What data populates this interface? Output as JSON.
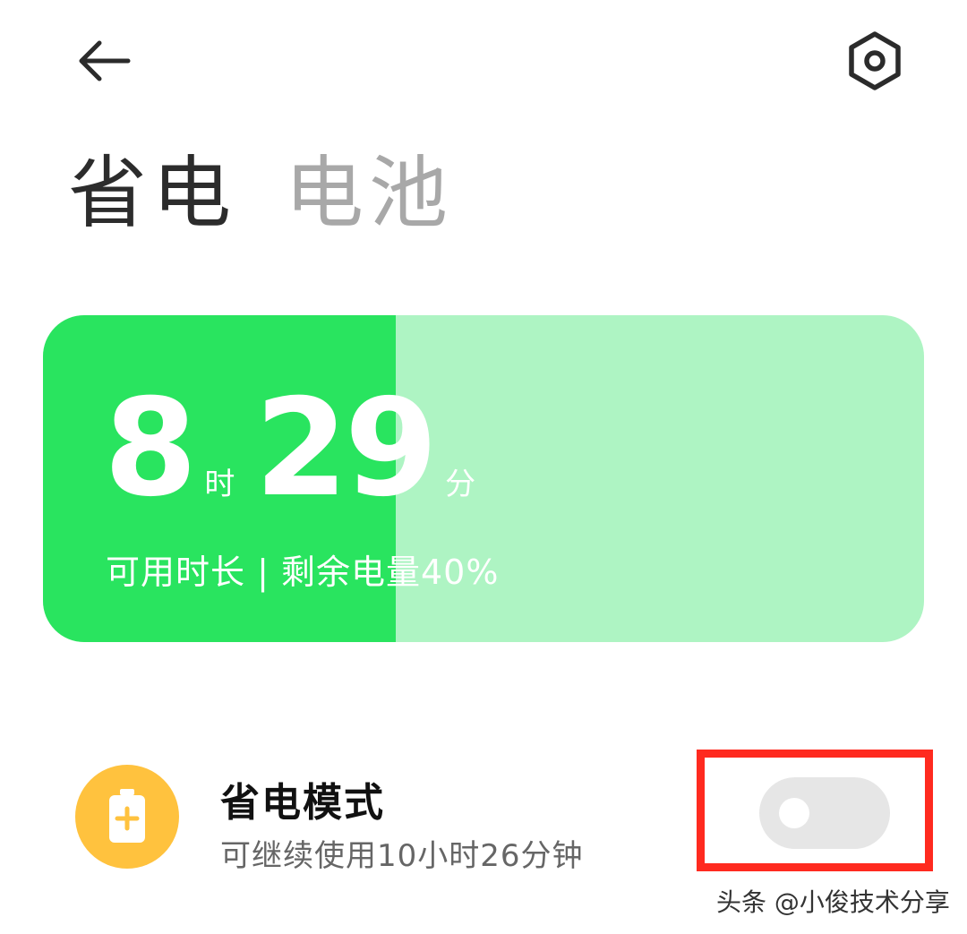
{
  "header": {
    "back_icon": "arrow-left-icon",
    "settings_icon": "gear-hexagon-icon"
  },
  "tabs": [
    {
      "label": "省电",
      "active": true
    },
    {
      "label": "电池",
      "active": false
    }
  ],
  "battery": {
    "hours": "8",
    "hours_unit": "时",
    "minutes": "29",
    "minutes_unit": "分",
    "caption": "可用时长 | 剩余电量40%",
    "level_fraction": 0.4,
    "fill_color": "#29e45f",
    "track_color": "#aef4c3"
  },
  "power_saving": {
    "icon": "battery-plus-icon",
    "title": "省电模式",
    "subtitle": "可继续使用10小时26分钟",
    "enabled": false
  },
  "watermark": "头条 @小俊技术分享"
}
